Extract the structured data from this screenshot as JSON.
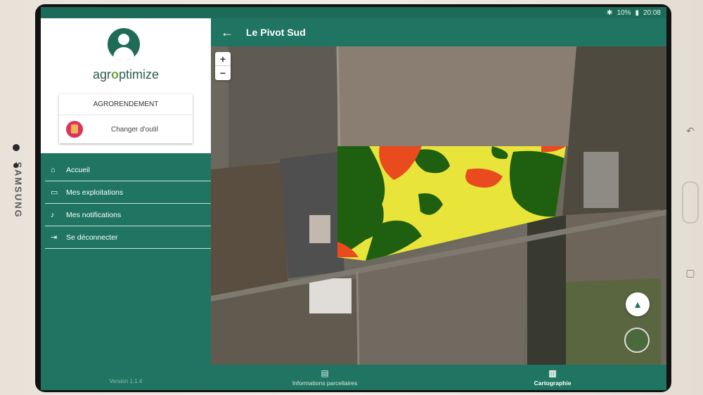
{
  "device": {
    "brand": "SAMSUNG"
  },
  "status_bar": {
    "battery": "10%",
    "time": "20:08"
  },
  "app_bar": {
    "title": "Le Pivot Sud"
  },
  "drawer": {
    "logo": {
      "part1": "agr",
      "part2": "o",
      "part3": "ptimize"
    },
    "tool": {
      "name": "AGRORENDEMENT",
      "change_label": "Changer d'outil"
    },
    "items": [
      {
        "label": "Accueil",
        "icon": "home-icon"
      },
      {
        "label": "Mes exploitations",
        "icon": "window-icon"
      },
      {
        "label": "Mes notifications",
        "icon": "bell-icon"
      },
      {
        "label": "Se déconnecter",
        "icon": "logout-icon"
      }
    ],
    "version": "Version 1.1.4"
  },
  "map": {
    "zoom_in": "+",
    "zoom_out": "−",
    "yield_colors": {
      "high": "#1e5f10",
      "medium": "#e8e43a",
      "low": "#e94b1f"
    }
  },
  "bottom_nav": {
    "tabs": [
      {
        "label": "Informations parcellaires",
        "icon": "document-icon",
        "active": false
      },
      {
        "label": "Cartographie",
        "icon": "map-icon",
        "active": true
      }
    ]
  }
}
